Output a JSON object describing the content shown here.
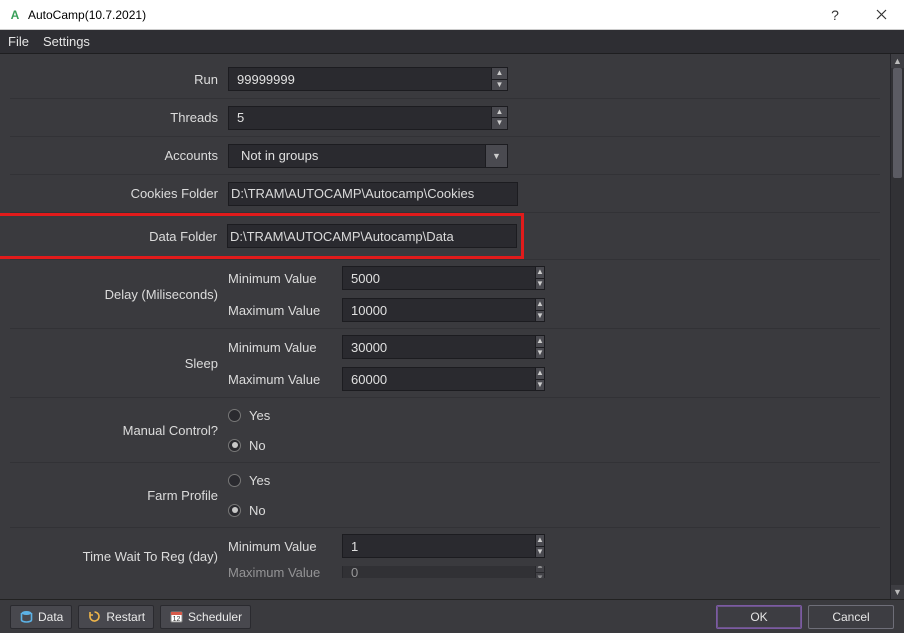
{
  "titlebar": {
    "title": "AutoCamp(10.7.2021)"
  },
  "menu": {
    "file": "File",
    "settings": "Settings"
  },
  "labels": {
    "run": "Run",
    "threads": "Threads",
    "accounts": "Accounts",
    "cookies_folder": "Cookies Folder",
    "data_folder": "Data Folder",
    "delay": "Delay (Miliseconds)",
    "sleep": "Sleep",
    "manual_control": "Manual Control?",
    "farm_profile": "Farm Profile",
    "time_wait_reg": "Time Wait To Reg (day)",
    "min_value": "Minimum Value",
    "max_value": "Maximum Value",
    "yes": "Yes",
    "no": "No"
  },
  "values": {
    "run": "99999999",
    "threads": "5",
    "accounts_selected": "Not in groups",
    "cookies_folder": "D:\\TRAM\\AUTOCAMP\\Autocamp\\Cookies",
    "data_folder": "D:\\TRAM\\AUTOCAMP\\Autocamp\\Data",
    "delay_min": "5000",
    "delay_max": "10000",
    "sleep_min": "30000",
    "sleep_max": "60000",
    "manual_control": "No",
    "farm_profile": "No",
    "reg_min": "1",
    "reg_max": "0"
  },
  "buttons": {
    "data": "Data",
    "restart": "Restart",
    "scheduler": "Scheduler",
    "ok": "OK",
    "cancel": "Cancel"
  }
}
